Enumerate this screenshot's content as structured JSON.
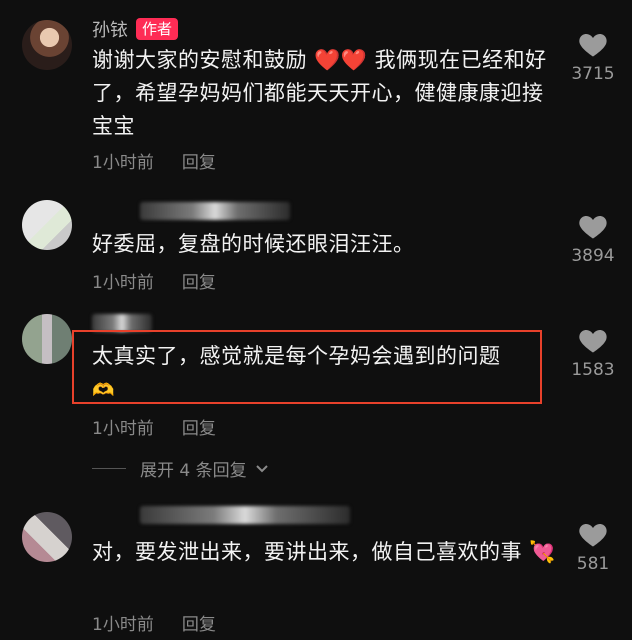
{
  "comments": [
    {
      "username": "孙铱",
      "badge": "作者",
      "text": "谢谢大家的安慰和鼓励 ❤️❤️ 我俩现在已经和好了，希望孕妈妈们都能天天开心，健健康康迎接宝宝",
      "time": "1小时前",
      "reply": "回复",
      "likes": "3715"
    },
    {
      "username": "",
      "text": "好委屈，复盘的时候还眼泪汪汪。",
      "time": "1小时前",
      "reply": "回复",
      "likes": "3894"
    },
    {
      "username": "",
      "text": "太真实了，感觉就是每个孕妈会遇到的问题",
      "emoji": "🫶",
      "time": "1小时前",
      "reply": "回复",
      "likes": "1583"
    },
    {
      "username": "",
      "text": "对，要发泄出来，要讲出来，做自己喜欢的事",
      "emoji": "💘",
      "time": "1小时前",
      "reply": "回复",
      "likes": "581"
    }
  ],
  "expand_replies": "展开 4 条回复",
  "icons": {
    "like": "heart-icon",
    "expand": "chevron-down-icon"
  },
  "colors": {
    "background": "#0f0f0f",
    "badge": "#fe2c55",
    "highlight": "#e8412b",
    "meta": "#8a8a8a"
  }
}
